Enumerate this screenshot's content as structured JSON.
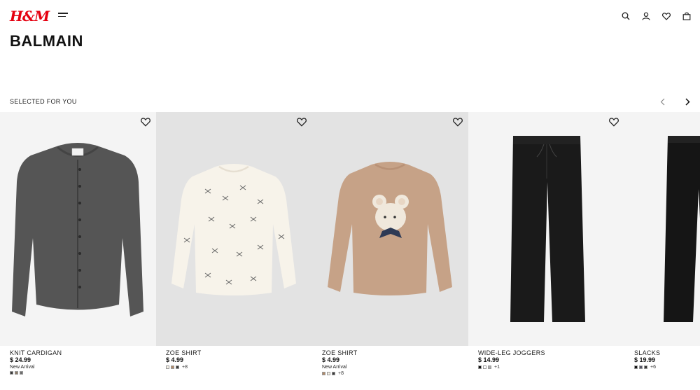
{
  "brand": {
    "logo": "H&M",
    "color": "#e50010"
  },
  "header": {
    "icons": [
      "search-icon",
      "account-icon",
      "heart-icon",
      "bag-icon"
    ]
  },
  "page": {
    "title": "BALMAIN"
  },
  "section": {
    "title": "SELECTED FOR YOU"
  },
  "products": [
    {
      "name": "KNIT CARDIGAN",
      "price": "$ 24.99",
      "badge": "New Arrival",
      "swatches": [
        "#3a3a3a",
        "#8a7a68",
        "#6e6e6e"
      ],
      "more": ""
    },
    {
      "name": "ZOE SHIRT",
      "price": "$ 4.99",
      "badge": "",
      "swatches": [
        "#f5f1e6",
        "#b08a6a",
        "#3a3a3a"
      ],
      "more": "+8"
    },
    {
      "name": "ZOE SHIRT",
      "price": "$ 4.99",
      "badge": "New Arrival",
      "swatches": [
        "#b08a6a",
        "#f5f1e6",
        "#3a3a3a"
      ],
      "more": "+8"
    },
    {
      "name": "WIDE-LEG JOGGERS",
      "price": "$ 14.99",
      "badge": "",
      "swatches": [
        "#111111",
        "#ffffff",
        "#aaaaaa"
      ],
      "more": "+1"
    },
    {
      "name": "SLACKS",
      "price": "$ 19.99",
      "badge": "",
      "swatches": [
        "#111111",
        "#555566",
        "#333333"
      ],
      "more": "+6"
    }
  ]
}
